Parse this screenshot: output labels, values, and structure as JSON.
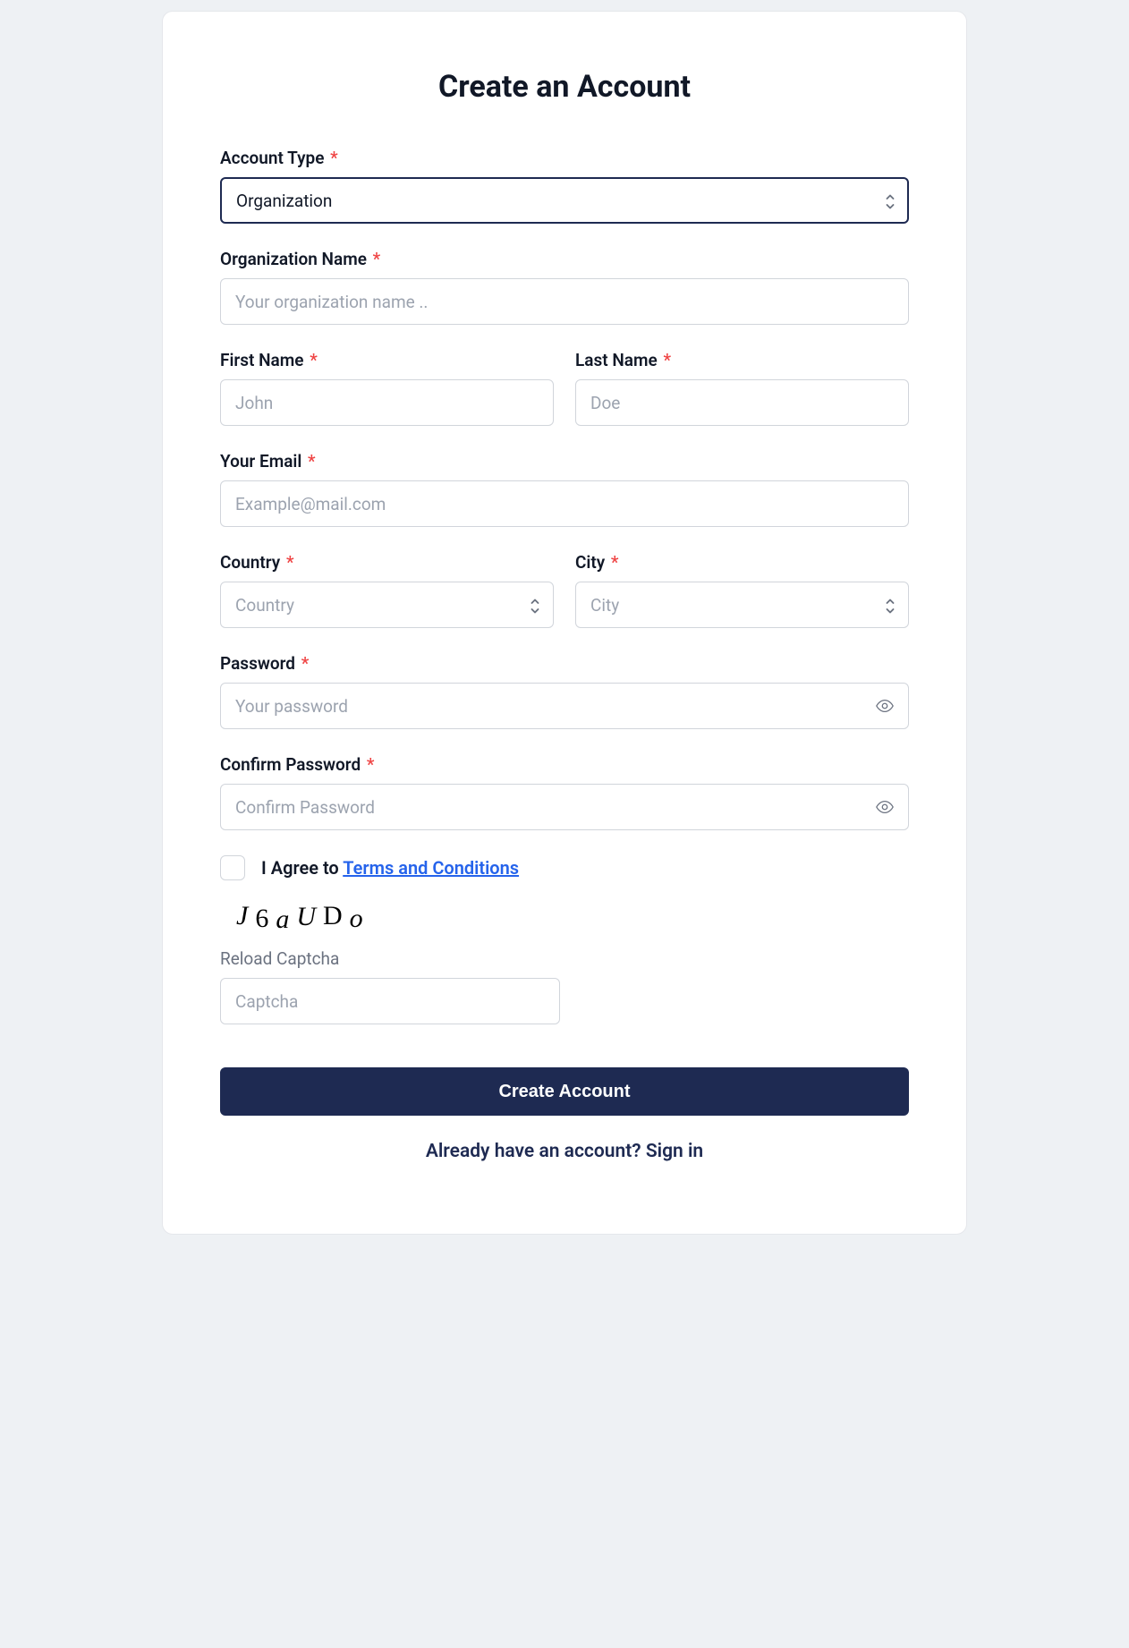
{
  "title": "Create an Account",
  "required_mark": "*",
  "fields": {
    "account_type": {
      "label": "Account Type",
      "value": "Organization"
    },
    "org_name": {
      "label": "Organization Name",
      "placeholder": "Your organization name .."
    },
    "first_name": {
      "label": "First Name",
      "placeholder": "John"
    },
    "last_name": {
      "label": "Last Name",
      "placeholder": "Doe"
    },
    "email": {
      "label": "Your Email",
      "placeholder": "Example@mail.com"
    },
    "country": {
      "label": "Country",
      "placeholder": "Country"
    },
    "city": {
      "label": "City",
      "placeholder": "City"
    },
    "password": {
      "label": "Password",
      "placeholder": "Your password"
    },
    "confirm": {
      "label": "Confirm Password",
      "placeholder": "Confirm Password"
    }
  },
  "agree": {
    "prefix": "I Agree to ",
    "link": "Terms and Conditions"
  },
  "captcha": {
    "text": "J6aUDo",
    "reload_label": "Reload Captcha",
    "placeholder": "Captcha"
  },
  "submit_label": "Create Account",
  "signin": {
    "prefix": "Already have an account? ",
    "link": "Sign in"
  }
}
